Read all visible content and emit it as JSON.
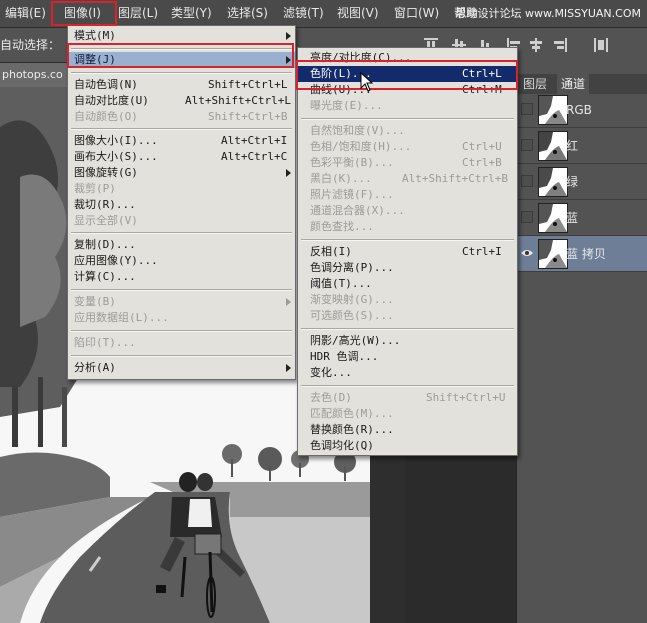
{
  "menubar": {
    "items": [
      {
        "label": "编辑(E)"
      },
      {
        "label": "图像(I)"
      },
      {
        "label": "图层(L)"
      },
      {
        "label": "类型(Y)"
      },
      {
        "label": "选择(S)"
      },
      {
        "label": "滤镜(T)"
      },
      {
        "label": "视图(V)"
      },
      {
        "label": "窗口(W)"
      },
      {
        "label": "帮助"
      }
    ],
    "watermark": "思缘设计论坛 www.MISSYUAN.COM"
  },
  "options": {
    "auto_select": "自动选择："
  },
  "document": {
    "tab": "photops.co"
  },
  "image_menu": {
    "items": [
      {
        "label": "模式(M)",
        "shortcut": "",
        "submenu": true
      },
      {
        "label": "调整(J)",
        "shortcut": "",
        "submenu": true
      },
      {
        "label": "自动色调(N)",
        "shortcut": "Shift+Ctrl+L"
      },
      {
        "label": "自动对比度(U)",
        "shortcut": "Alt+Shift+Ctrl+L"
      },
      {
        "label": "自动颜色(O)",
        "shortcut": "Shift+Ctrl+B"
      },
      {
        "label": "图像大小(I)...",
        "shortcut": "Alt+Ctrl+I"
      },
      {
        "label": "画布大小(S)...",
        "shortcut": "Alt+Ctrl+C"
      },
      {
        "label": "图像旋转(G)",
        "shortcut": "",
        "submenu": true
      },
      {
        "label": "裁剪(P)",
        "shortcut": ""
      },
      {
        "label": "裁切(R)...",
        "shortcut": ""
      },
      {
        "label": "显示全部(V)",
        "shortcut": ""
      },
      {
        "label": "复制(D)...",
        "shortcut": ""
      },
      {
        "label": "应用图像(Y)...",
        "shortcut": ""
      },
      {
        "label": "计算(C)...",
        "shortcut": ""
      },
      {
        "label": "变量(B)",
        "shortcut": "",
        "submenu": true
      },
      {
        "label": "应用数据组(L)...",
        "shortcut": ""
      },
      {
        "label": "陷印(T)...",
        "shortcut": ""
      },
      {
        "label": "分析(A)",
        "shortcut": "",
        "submenu": true
      }
    ]
  },
  "adjust_menu": {
    "items": [
      {
        "label": "亮度/对比度(C)...",
        "shortcut": ""
      },
      {
        "label": "色阶(L)...",
        "shortcut": "Ctrl+L"
      },
      {
        "label": "曲线(U)...",
        "shortcut": "Ctrl+M"
      },
      {
        "label": "曝光度(E)...",
        "shortcut": ""
      },
      {
        "label": "自然饱和度(V)...",
        "shortcut": ""
      },
      {
        "label": "色相/饱和度(H)...",
        "shortcut": "Ctrl+U"
      },
      {
        "label": "色彩平衡(B)...",
        "shortcut": "Ctrl+B"
      },
      {
        "label": "黑白(K)...",
        "shortcut": "Alt+Shift+Ctrl+B"
      },
      {
        "label": "照片滤镜(F)...",
        "shortcut": ""
      },
      {
        "label": "通道混合器(X)...",
        "shortcut": ""
      },
      {
        "label": "颜色查找...",
        "shortcut": ""
      },
      {
        "label": "反相(I)",
        "shortcut": "Ctrl+I"
      },
      {
        "label": "色调分离(P)...",
        "shortcut": ""
      },
      {
        "label": "阈值(T)...",
        "shortcut": ""
      },
      {
        "label": "渐变映射(G)...",
        "shortcut": ""
      },
      {
        "label": "可选颜色(S)...",
        "shortcut": ""
      },
      {
        "label": "阴影/高光(W)...",
        "shortcut": ""
      },
      {
        "label": "HDR 色调...",
        "shortcut": ""
      },
      {
        "label": "变化...",
        "shortcut": ""
      },
      {
        "label": "去色(D)",
        "shortcut": "Shift+Ctrl+U"
      },
      {
        "label": "匹配颜色(M)...",
        "shortcut": ""
      },
      {
        "label": "替换颜色(R)...",
        "shortcut": ""
      },
      {
        "label": "色调均化(Q)",
        "shortcut": ""
      }
    ]
  },
  "panel": {
    "tabs": [
      {
        "label": "图层"
      },
      {
        "label": "通道"
      }
    ],
    "channels": [
      {
        "label": "RGB"
      },
      {
        "label": "红"
      },
      {
        "label": "绿"
      },
      {
        "label": "蓝"
      },
      {
        "label": "蓝 拷贝"
      }
    ]
  },
  "colors": {
    "highlight": "#132a6b",
    "annotation_red": "#d8232a",
    "menu_bg": "#e3e1dc",
    "active_channel": "#6e7e96"
  }
}
